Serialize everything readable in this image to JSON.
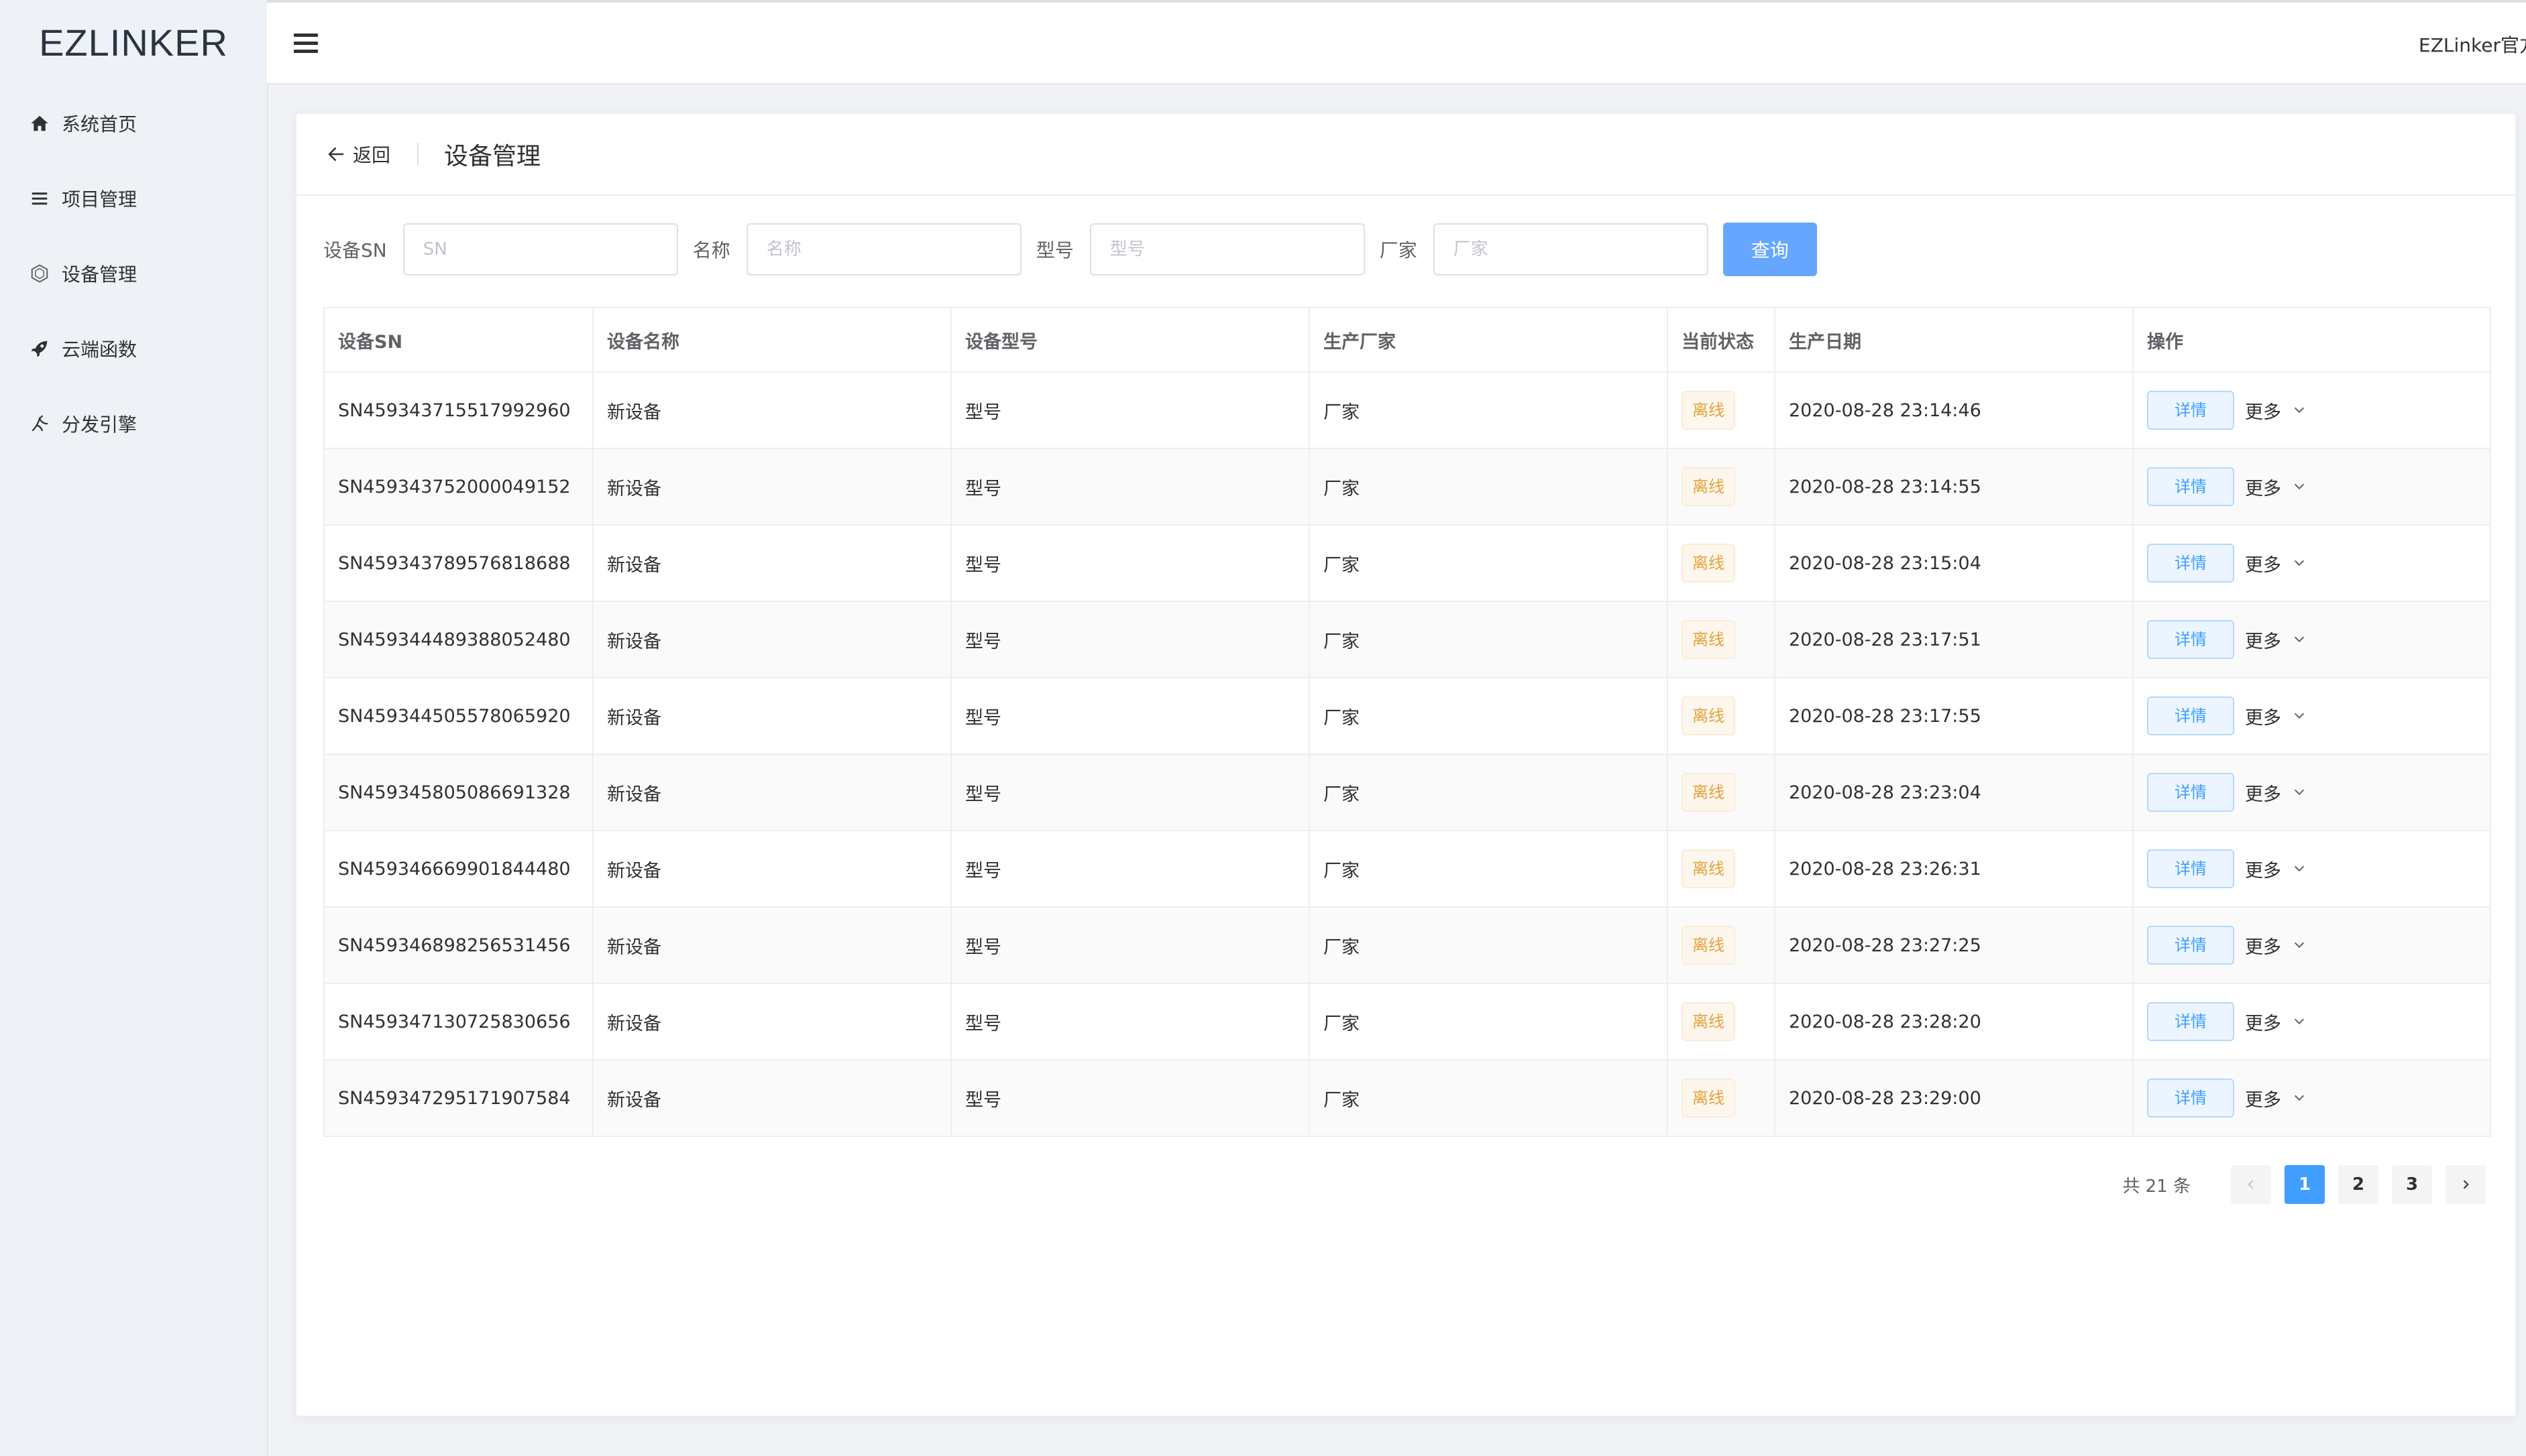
{
  "app": {
    "logo": "EZLINKER",
    "user": "EZLinker官方"
  },
  "sidebar": {
    "items": [
      {
        "label": "系统首页",
        "icon": "home-icon"
      },
      {
        "label": "项目管理",
        "icon": "list-icon"
      },
      {
        "label": "设备管理",
        "icon": "device-icon"
      },
      {
        "label": "云端函数",
        "icon": "rocket-icon"
      },
      {
        "label": "分发引擎",
        "icon": "engine-icon"
      }
    ]
  },
  "page": {
    "back_label": "返回",
    "title": "设备管理"
  },
  "filters": {
    "sn_label": "设备SN",
    "sn_placeholder": "SN",
    "name_label": "名称",
    "name_placeholder": "名称",
    "model_label": "型号",
    "model_placeholder": "型号",
    "vendor_label": "厂家",
    "vendor_placeholder": "厂家",
    "query_label": "查询"
  },
  "table": {
    "headers": [
      "设备SN",
      "设备名称",
      "设备型号",
      "生产厂家",
      "当前状态",
      "生产日期",
      "操作"
    ],
    "detail_label": "详情",
    "more_label": "更多",
    "rows": [
      {
        "sn": "SN459343715517992960",
        "name": "新设备",
        "model": "型号",
        "vendor": "厂家",
        "status": "离线",
        "date": "2020-08-28 23:14:46"
      },
      {
        "sn": "SN459343752000049152",
        "name": "新设备",
        "model": "型号",
        "vendor": "厂家",
        "status": "离线",
        "date": "2020-08-28 23:14:55"
      },
      {
        "sn": "SN459343789576818688",
        "name": "新设备",
        "model": "型号",
        "vendor": "厂家",
        "status": "离线",
        "date": "2020-08-28 23:15:04"
      },
      {
        "sn": "SN459344489388052480",
        "name": "新设备",
        "model": "型号",
        "vendor": "厂家",
        "status": "离线",
        "date": "2020-08-28 23:17:51"
      },
      {
        "sn": "SN459344505578065920",
        "name": "新设备",
        "model": "型号",
        "vendor": "厂家",
        "status": "离线",
        "date": "2020-08-28 23:17:55"
      },
      {
        "sn": "SN459345805086691328",
        "name": "新设备",
        "model": "型号",
        "vendor": "厂家",
        "status": "离线",
        "date": "2020-08-28 23:23:04"
      },
      {
        "sn": "SN459346669901844480",
        "name": "新设备",
        "model": "型号",
        "vendor": "厂家",
        "status": "离线",
        "date": "2020-08-28 23:26:31"
      },
      {
        "sn": "SN459346898256531456",
        "name": "新设备",
        "model": "型号",
        "vendor": "厂家",
        "status": "离线",
        "date": "2020-08-28 23:27:25"
      },
      {
        "sn": "SN459347130725830656",
        "name": "新设备",
        "model": "型号",
        "vendor": "厂家",
        "status": "离线",
        "date": "2020-08-28 23:28:20"
      },
      {
        "sn": "SN459347295171907584",
        "name": "新设备",
        "model": "型号",
        "vendor": "厂家",
        "status": "离线",
        "date": "2020-08-28 23:29:00"
      }
    ]
  },
  "pagination": {
    "total": "共 21 条",
    "pages": [
      "1",
      "2",
      "3"
    ],
    "current": "1"
  },
  "colors": {
    "primary": "#409eff",
    "query_button": "#66a6ff",
    "warning": "#e6a23c"
  }
}
